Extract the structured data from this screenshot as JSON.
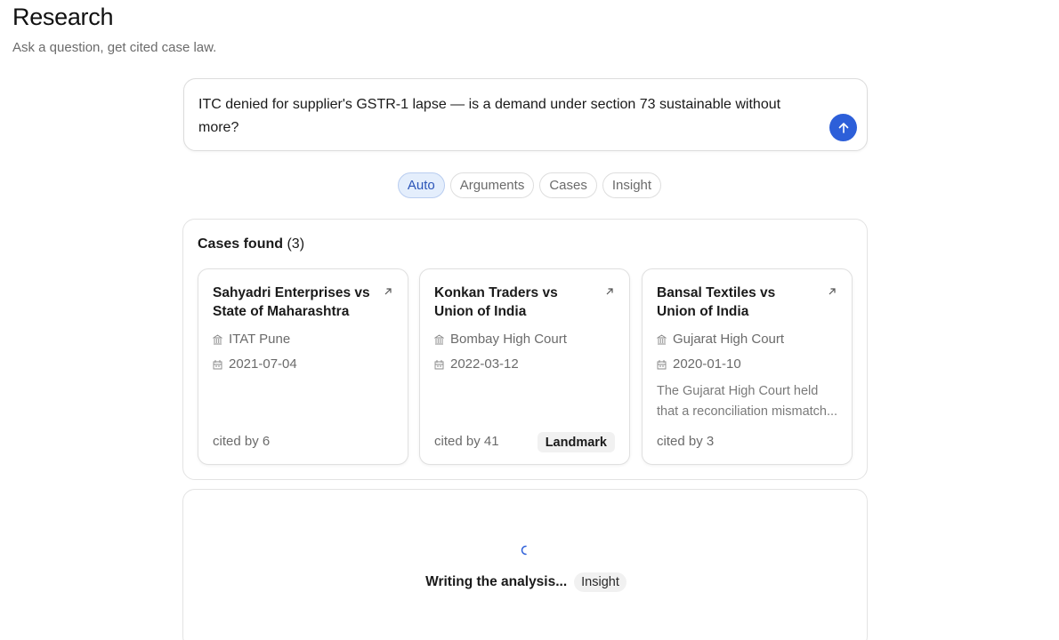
{
  "header": {
    "title": "Research",
    "subtitle": "Ask a question, get cited case law."
  },
  "query": {
    "text": "ITC denied for supplier's GSTR-1 lapse — is a demand under section 73 sustainable without more?",
    "send_icon": "arrow-up-icon",
    "accent_color": "#2d5fd9"
  },
  "modes": [
    {
      "label": "Auto",
      "active": true
    },
    {
      "label": "Arguments",
      "active": false
    },
    {
      "label": "Cases",
      "active": false
    },
    {
      "label": "Insight",
      "active": false
    }
  ],
  "cases_section": {
    "heading": "Cases found",
    "count": "(3)",
    "cases": [
      {
        "title": "Sahyadri Enterprises vs State of Maharashtra",
        "court": "ITAT Pune",
        "date": "2021-07-04",
        "summary_line_1": "",
        "summary_line_2": "",
        "cited_by": "cited by 6",
        "badge": ""
      },
      {
        "title": "Konkan Traders vs Union of India",
        "court": "Bombay High Court",
        "date": "2022-03-12",
        "summary_line_1": "",
        "summary_line_2": "",
        "cited_by": "cited by 41",
        "badge": "Landmark"
      },
      {
        "title": "Bansal Textiles vs Union of India",
        "court": "Gujarat High Court",
        "date": "2020-01-10",
        "summary_line_1": "The Gujarat High Court held",
        "summary_line_2": "that a reconciliation mismatch...",
        "cited_by": "cited by 3",
        "badge": ""
      }
    ]
  },
  "analysis": {
    "status_text": "Writing the analysis...",
    "badge": "Insight"
  }
}
